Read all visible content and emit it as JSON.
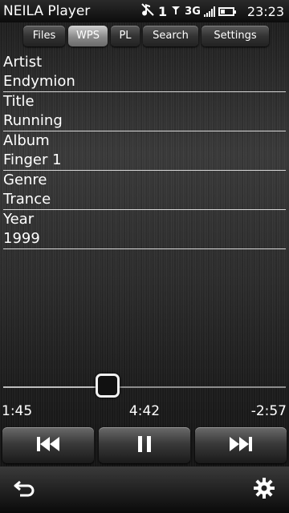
{
  "statusbar": {
    "app_title": "NEILA Player",
    "notification_count": "1",
    "network": "3G",
    "battery_level": 0.35,
    "clock": "23:23"
  },
  "tabs": [
    {
      "label": "Files",
      "active": false
    },
    {
      "label": "WPS",
      "active": true
    },
    {
      "label": "PL",
      "active": false
    },
    {
      "label": "Search",
      "active": false
    },
    {
      "label": "Settings",
      "active": false
    }
  ],
  "track": {
    "fields": [
      {
        "label": "Artist",
        "value": "Endymion"
      },
      {
        "label": "Title",
        "value": "Running"
      },
      {
        "label": "Album",
        "value": "Finger 1"
      },
      {
        "label": "Genre",
        "value": "Trance"
      },
      {
        "label": "Year",
        "value": "1999"
      }
    ]
  },
  "playback": {
    "elapsed": "1:45",
    "total": "4:42",
    "remaining": "-2:57",
    "progress": 0.37
  },
  "icons": {
    "prev": "skip-previous-icon",
    "pause": "pause-icon",
    "next": "skip-next-icon",
    "back": "back-arrow-icon",
    "settings": "gear-icon",
    "muted": "muted-note-icon",
    "signal": "signal-bars-icon",
    "battery": "battery-icon"
  }
}
